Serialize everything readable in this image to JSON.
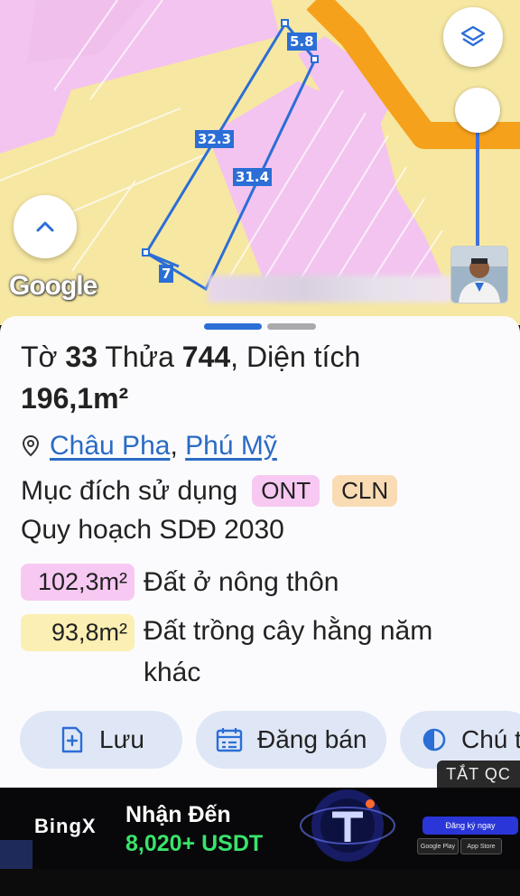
{
  "map": {
    "google_logo": "Google",
    "dimensions": [
      "5.8",
      "32.3",
      "31.4",
      "7"
    ],
    "colors": {
      "residential": "#f3c4ef",
      "perennial": "#f6e7a2",
      "road": "#f5a11b",
      "parcel_line": "#2b6ed6"
    }
  },
  "parcel": {
    "title_prefix": "Tờ",
    "sheet_no": "33",
    "plot_label": "Thửa",
    "plot_no": "744",
    "area_label": ", Diện tích",
    "area_value": "196,1m²",
    "location_commune": "Châu Pha",
    "location_sep": ",",
    "location_town": "Phú Mỹ",
    "purpose_label": "Mục đích sử dụng",
    "purpose_codes": [
      "ONT",
      "CLN"
    ],
    "planning_label": "Quy hoạch SDĐ 2030",
    "plan_items": [
      {
        "area": "102,3m²",
        "desc": "Đất ở nông thôn",
        "color": "#f7c9f2"
      },
      {
        "area": "93,8m²",
        "desc": "Đất trồng cây hằng năm khác",
        "color": "#fbefb3"
      }
    ]
  },
  "actions": [
    {
      "label": "Lưu",
      "icon": "bookmark-add-icon"
    },
    {
      "label": "Đăng bán",
      "icon": "calendar-list-icon"
    },
    {
      "label": "Chú t",
      "icon": "contrast-icon"
    }
  ],
  "ad": {
    "close_label": "TẮT QC",
    "brand": "BingX",
    "headline": "Nhận Đến",
    "amount": "8,020+ USDT",
    "cta": "Đăng ký ngay",
    "store1": "Google Play",
    "store2": "App Store"
  }
}
